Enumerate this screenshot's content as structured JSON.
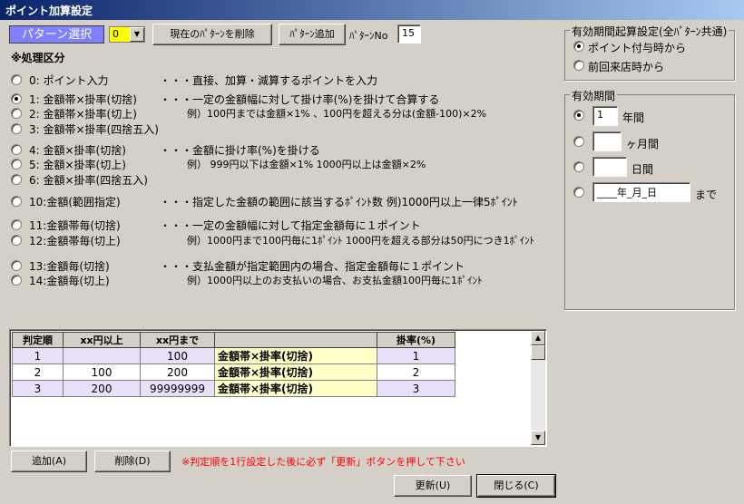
{
  "window": {
    "title": "ポイント加算設定"
  },
  "pattern": {
    "label": "パターン選択",
    "selected": "0",
    "delete_button": "現在のﾊﾟﾀｰﾝを削除",
    "add_button": "ﾊﾟﾀｰﾝ追加",
    "no_label": "ﾊﾟﾀｰﾝNo",
    "no_value": "15"
  },
  "section": {
    "title": "※処理区分"
  },
  "options": [
    {
      "code": "0: ポイント入力",
      "desc": "・・・直接、加算・減算するポイントを入力",
      "ex": ""
    },
    {
      "code": "1: 金額帯×掛率(切捨)",
      "desc": "・・・一定の金額幅に対して掛け率(%)を掛けて合算する",
      "ex": ""
    },
    {
      "code": "2: 金額帯×掛率(切上)",
      "desc": "",
      "ex": "例）100円までは金額×1% 、100円を超える分は(金額-100)×2%"
    },
    {
      "code": "3: 金額帯×掛率(四捨五入)",
      "desc": "",
      "ex": ""
    },
    {
      "code": "4: 金額×掛率(切捨)",
      "desc": "・・・金額に掛け率(%)を掛ける",
      "ex": ""
    },
    {
      "code": "5: 金額×掛率(切上)",
      "desc": "",
      "ex": "例） 999円以下は金額×1%      1000円以上は金額×2%"
    },
    {
      "code": "6: 金額×掛率(四捨五入)",
      "desc": "",
      "ex": ""
    },
    {
      "code": "10:金額(範囲指定)",
      "desc": "・・・指定した金額の範囲に該当するﾎﾟｲﾝﾄ数    例)1000円以上一律5ﾎﾟｲﾝﾄ",
      "ex": ""
    },
    {
      "code": "11:金額帯毎(切捨)",
      "desc": "・・・一定の金額幅に対して指定金額毎に１ポイント",
      "ex": ""
    },
    {
      "code": "12:金額帯毎(切上)",
      "desc": "",
      "ex": "例）1000円まで100円毎に1ﾎﾟｲﾝﾄ  1000円を超える部分は50円につき1ﾎﾟｲﾝﾄ"
    },
    {
      "code": "13:金額毎(切捨)",
      "desc": "・・・支払金額が指定範囲内の場合、指定金額毎に１ポイント",
      "ex": ""
    },
    {
      "code": "14:金額毎(切上)",
      "desc": "",
      "ex": "例）1000円以上のお支払いの場合、お支払金額100円毎に1ﾎﾟｲﾝﾄ"
    }
  ],
  "selected_option": 1,
  "grid": {
    "headers": [
      "判定順",
      "xx円以上",
      "xx円まで",
      "",
      "掛率(%)"
    ],
    "rows": [
      [
        "1",
        "",
        "100",
        "金額帯×掛率(切捨)",
        "1"
      ],
      [
        "2",
        "100",
        "200",
        "金額帯×掛率(切捨)",
        "2"
      ],
      [
        "3",
        "200",
        "99999999",
        "金額帯×掛率(切捨)",
        "3"
      ]
    ]
  },
  "actions": {
    "add": "追加(A)",
    "delete": "削除(D)",
    "note": "※判定順を1行設定した後に必ず「更新」ボタンを押して下さい",
    "update": "更新(U)",
    "close": "閉じる(C)"
  },
  "validity_start": {
    "title": "有効期間起算設定(全ﾊﾟﾀｰﾝ共通)",
    "opt1": "ポイント付与時から",
    "opt2": "前回来店時から"
  },
  "validity": {
    "title": "有効期間",
    "years_value": "1",
    "years_unit": "年間",
    "months_unit": "ヶ月間",
    "days_unit": "日間",
    "date_value": "____年_月_日",
    "date_suffix": "まで"
  },
  "colors": {
    "title_start": "#0a246a",
    "title_end": "#a6caf0",
    "pattern_bg": "#8080ff",
    "combo_bg": "#ffff00",
    "row_odd": "#e8e0f8",
    "row_mid": "#ffffc8",
    "note": "#ff0000"
  }
}
